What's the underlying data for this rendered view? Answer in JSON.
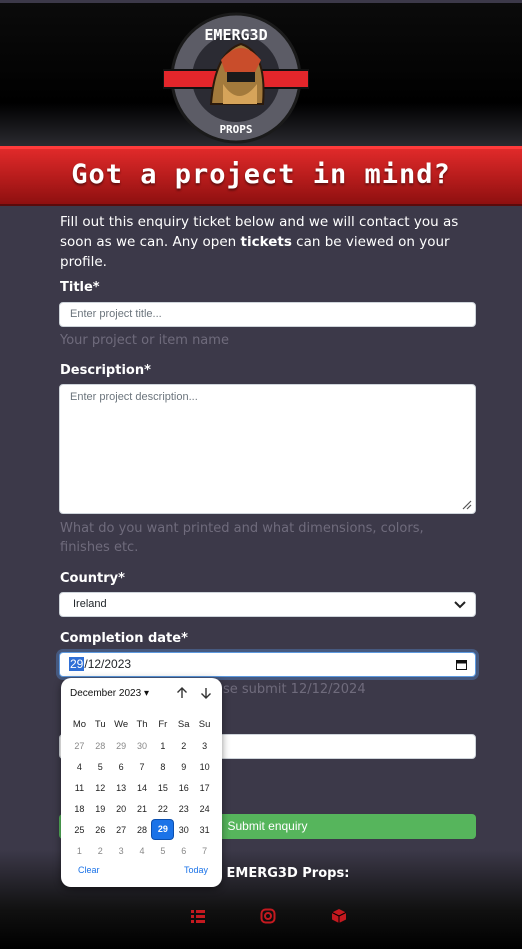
{
  "logo": {
    "top_text": "EMERG3D",
    "bottom_text": "PROPS"
  },
  "banner": {
    "title": "Got a project in mind?"
  },
  "intro": {
    "text_before": "Fill out this enquiry ticket below and we will contact you as soon as we can. Any open ",
    "link_text": "tickets",
    "text_after": " can be viewed on your profile."
  },
  "form": {
    "title": {
      "label": "Title*",
      "placeholder": "Enter project title...",
      "help": "Your project or item name"
    },
    "description": {
      "label": "Description*",
      "placeholder": "Enter project description...",
      "help": "What do you want printed and what dimensions, colors, finishes etc."
    },
    "country": {
      "label": "Country*",
      "value": "Ireland"
    },
    "completion_date": {
      "label": "Completion date*",
      "day": "29",
      "rest": "/12/2023",
      "help_visible": "se submit 12/12/2024"
    },
    "submit_label": "Submit enquiry"
  },
  "datepicker": {
    "month_label": "December 2023",
    "weekdays": [
      "Mo",
      "Tu",
      "We",
      "Th",
      "Fr",
      "Sa",
      "Su"
    ],
    "weeks": [
      [
        "27",
        "28",
        "29",
        "30",
        "1",
        "2",
        "3"
      ],
      [
        "4",
        "5",
        "6",
        "7",
        "8",
        "9",
        "10"
      ],
      [
        "11",
        "12",
        "13",
        "14",
        "15",
        "16",
        "17"
      ],
      [
        "18",
        "19",
        "20",
        "21",
        "22",
        "23",
        "24"
      ],
      [
        "25",
        "26",
        "27",
        "28",
        "29",
        "30",
        "31"
      ],
      [
        "1",
        "2",
        "3",
        "4",
        "5",
        "6",
        "7"
      ]
    ],
    "clear_label": "Clear",
    "today_label": "Today"
  },
  "footer": {
    "follow_visible": "w EMERG3D Props:"
  },
  "colors": {
    "brand_red": "#d42a2a",
    "accent_blue": "#1b73e8",
    "submit_green": "#56b55c",
    "page_bg": "#3c3949"
  }
}
